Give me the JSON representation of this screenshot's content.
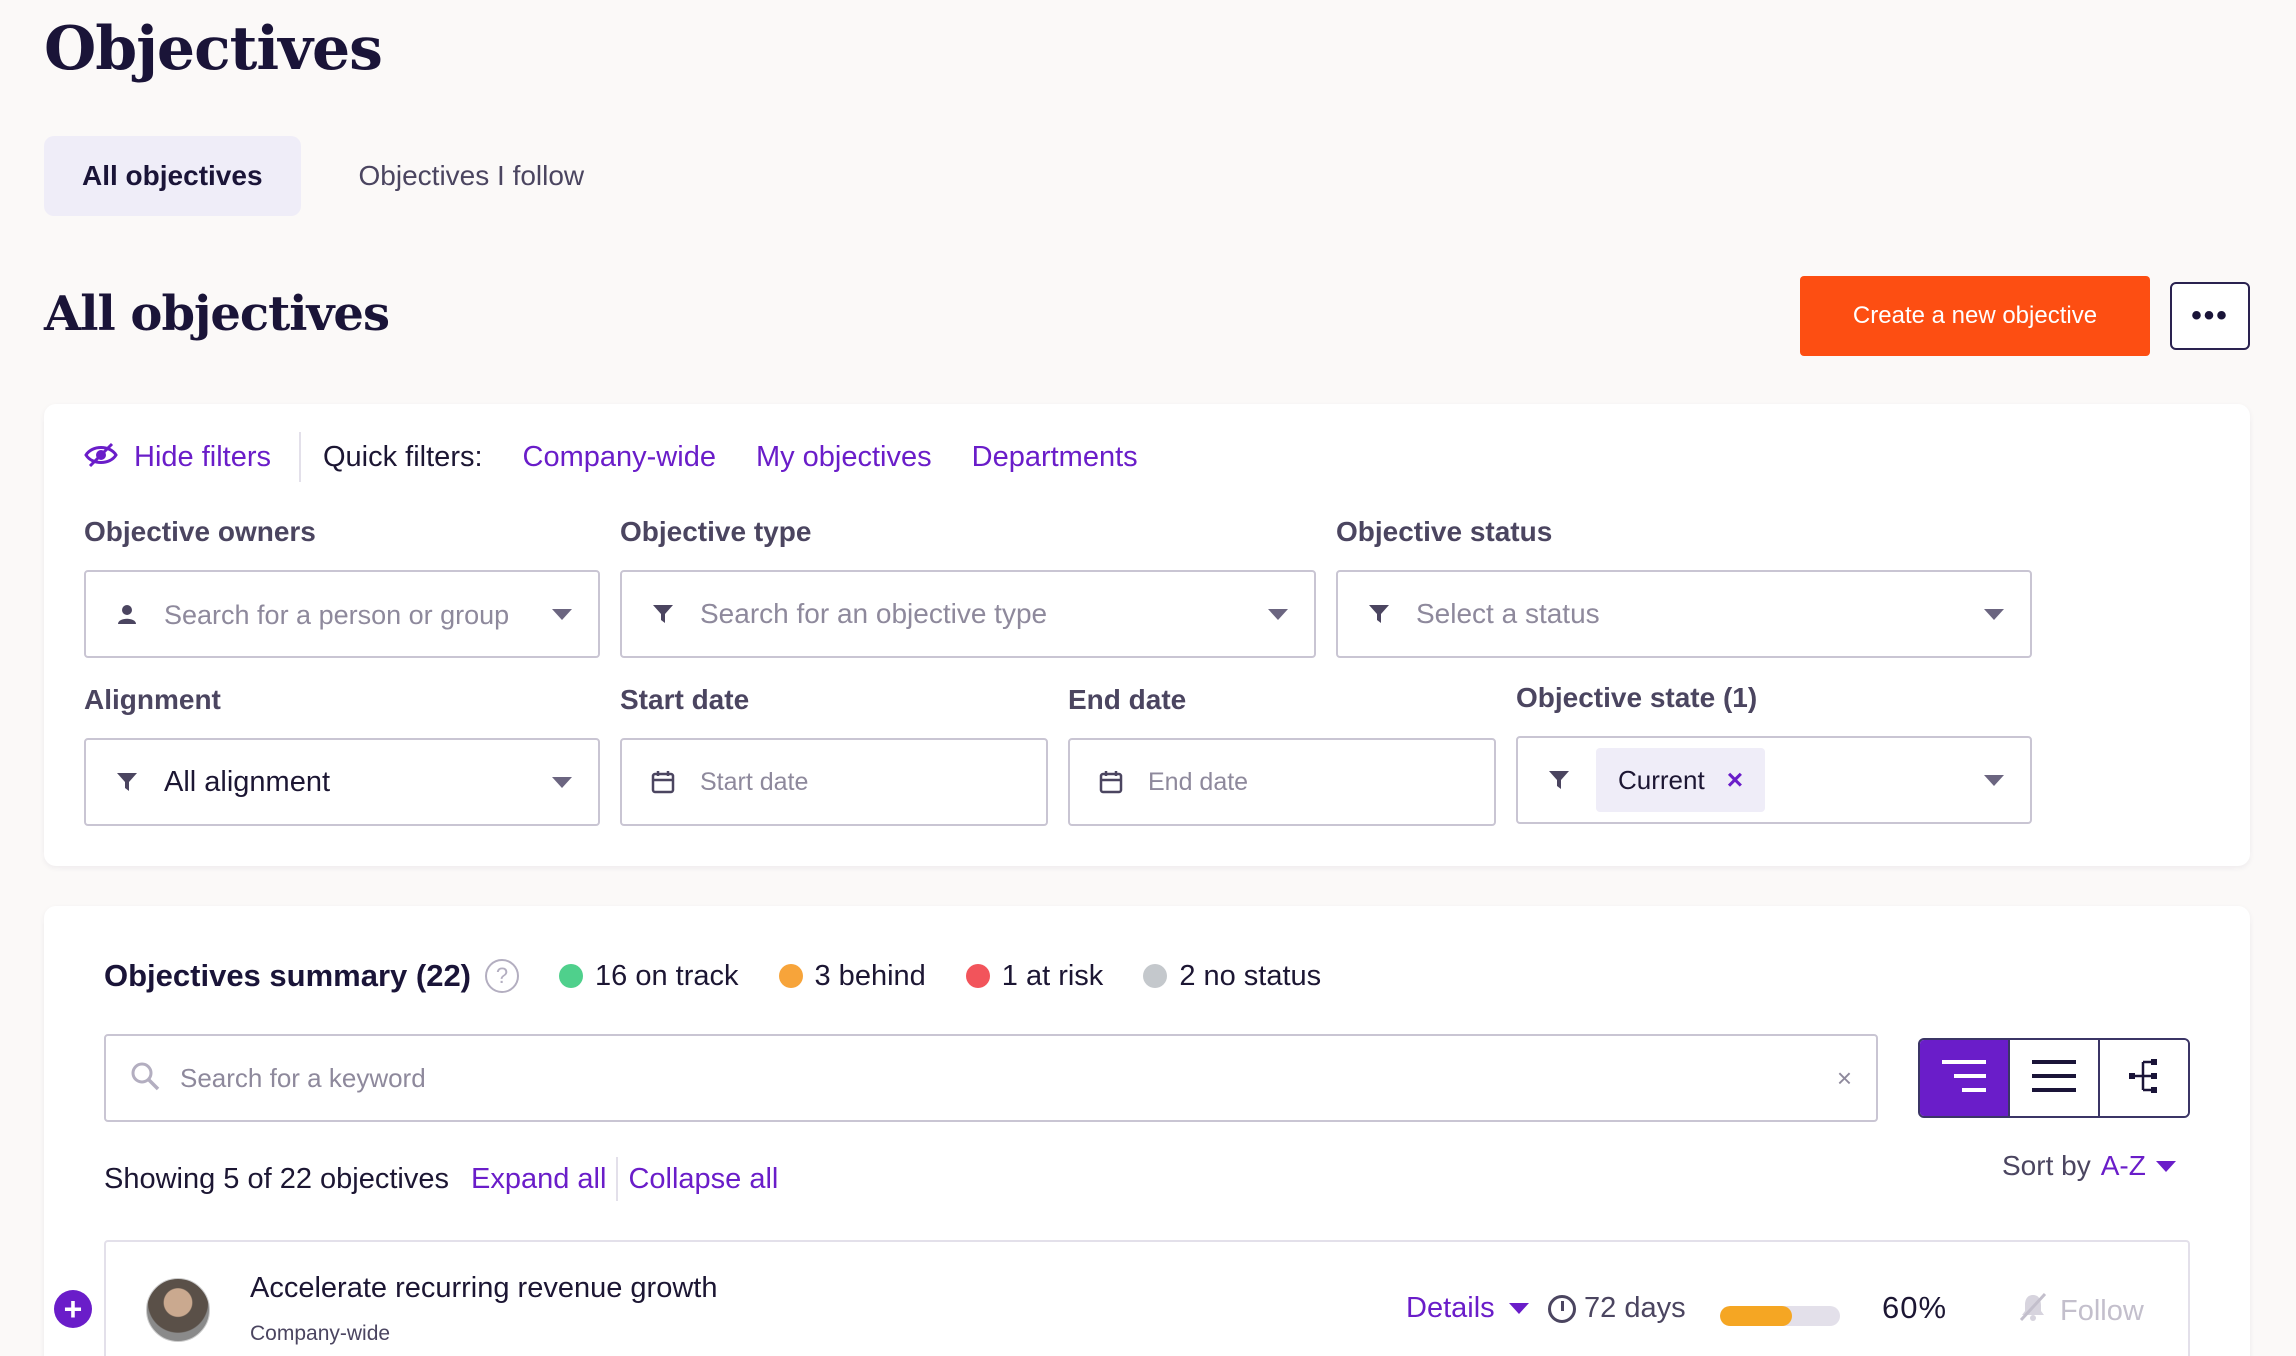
{
  "page": {
    "title": "Objectives"
  },
  "tabs": [
    {
      "label": "All objectives",
      "active": true
    },
    {
      "label": "Objectives I follow",
      "active": false
    }
  ],
  "section": {
    "title": "All objectives",
    "create_button": "Create a new objective",
    "more_button": "•••"
  },
  "filters": {
    "hide_label": "Hide filters",
    "quick_label": "Quick filters:",
    "quick": [
      "Company-wide",
      "My objectives",
      "Departments"
    ],
    "owners": {
      "label": "Objective owners",
      "placeholder": "Search for a person or group",
      "icon": "user-icon"
    },
    "type": {
      "label": "Objective type",
      "placeholder": "Search for an objective type",
      "icon": "filter-icon"
    },
    "status": {
      "label": "Objective status",
      "placeholder": "Select a status",
      "icon": "filter-icon"
    },
    "alignment": {
      "label": "Alignment",
      "value": "All alignment",
      "icon": "filter-icon"
    },
    "start_date": {
      "label": "Start date",
      "placeholder": "Start date",
      "icon": "calendar-icon"
    },
    "end_date": {
      "label": "End date",
      "placeholder": "End date",
      "icon": "calendar-icon"
    },
    "state": {
      "label": "Objective state (1)",
      "chip": "Current",
      "chip_remove": "×"
    }
  },
  "summary": {
    "title": "Objectives summary (22)",
    "help": "?",
    "stats": [
      {
        "label": "16 on track",
        "color": "#4fd08c"
      },
      {
        "label": "3 behind",
        "color": "#f7a43a"
      },
      {
        "label": "1 at risk",
        "color": "#f2545b"
      },
      {
        "label": "2 no status",
        "color": "#c4c8cc"
      }
    ],
    "search_placeholder": "Search for a keyword",
    "clear": "×",
    "views": [
      "tree-view-icon",
      "list-view-icon",
      "hierarchy-view-icon"
    ],
    "showing": "Showing 5 of 22 objectives",
    "expand_all": "Expand all",
    "collapse_all": "Collapse all",
    "sort_label": "Sort by",
    "sort_value": "A-Z"
  },
  "objectives": [
    {
      "title": "Accelerate recurring revenue growth",
      "subtitle": "Company-wide",
      "details": "Details",
      "days": "72 days",
      "progress": 0.6,
      "percent": "60%",
      "follow": "Follow",
      "expand": "+"
    }
  ],
  "colors": {
    "accent": "#6a1dc9",
    "primary_button": "#fd4e12"
  }
}
